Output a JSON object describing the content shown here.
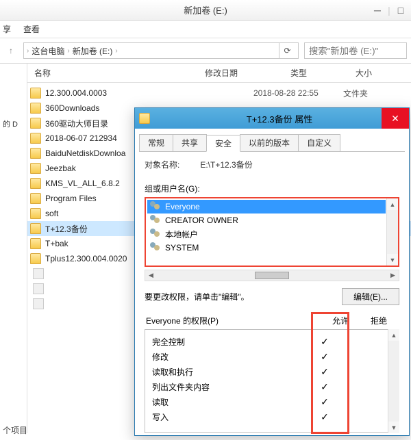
{
  "explorer": {
    "title": "新加卷 (E:)",
    "menu": {
      "share": "享",
      "view": "查看"
    },
    "breadcrumb": {
      "sep1": "›",
      "pc": "这台电脑",
      "sep2": "›",
      "vol": "新加卷 (E:)",
      "sep3": "›"
    },
    "search_placeholder": "搜索\"新加卷 (E:)\"",
    "columns": {
      "name": "名称",
      "modified": "修改日期",
      "type": "类型",
      "size": "大小"
    },
    "sidebar_label": "的 D",
    "items": [
      {
        "label": "12.300.004.0003",
        "date": "2018-08-28 22:55",
        "type": "文件夹"
      },
      {
        "label": "360Downloads"
      },
      {
        "label": "360驱动大师目录"
      },
      {
        "label": "2018-06-07 212934"
      },
      {
        "label": "BaiduNetdiskDownloa"
      },
      {
        "label": "Jeezbak"
      },
      {
        "label": "KMS_VL_ALL_6.8.2"
      },
      {
        "label": "Program Files"
      },
      {
        "label": "soft"
      },
      {
        "label": "T+12.3备份",
        "selected": true
      },
      {
        "label": "T+bak"
      },
      {
        "label": "Tplus12.300.004.0020"
      }
    ],
    "unknown_suffix": "20",
    "footer": "个项目"
  },
  "props": {
    "title": "T+12.3备份 属性",
    "tabs": {
      "general": "常规",
      "share": "共享",
      "security": "安全",
      "prev": "以前的版本",
      "custom": "自定义"
    },
    "object_name_label": "对象名称:",
    "object_name_value": "E:\\T+12.3备份",
    "group_label": "组或用户名(G):",
    "groups": [
      {
        "name": "Everyone",
        "selected": true
      },
      {
        "name": "CREATOR OWNER"
      },
      {
        "name": "本地帐户"
      },
      {
        "name": "SYSTEM"
      }
    ],
    "edit_hint": "要更改权限，请单击\"编辑\"。",
    "edit_btn": "编辑(E)...",
    "perm_of": "Everyone 的权限(P)",
    "allow_label": "允许",
    "deny_label": "拒绝",
    "perms": [
      {
        "name": "完全控制",
        "allow": true
      },
      {
        "name": "修改",
        "allow": true
      },
      {
        "name": "读取和执行",
        "allow": true
      },
      {
        "name": "列出文件夹内容",
        "allow": true
      },
      {
        "name": "读取",
        "allow": true
      },
      {
        "name": "写入",
        "allow": true
      }
    ]
  }
}
